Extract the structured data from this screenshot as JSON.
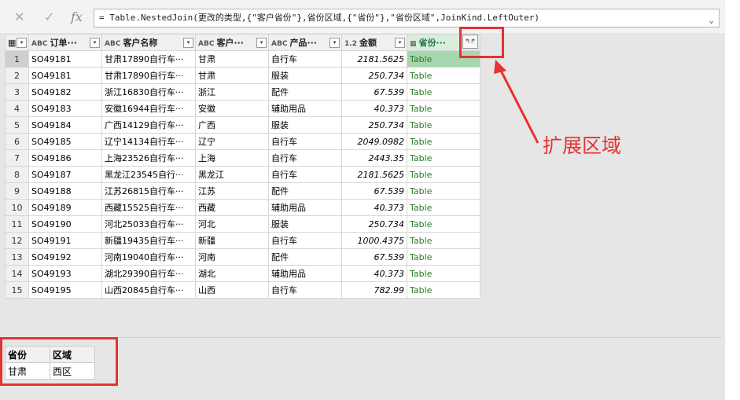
{
  "formula_bar": {
    "cancel_icon": "✕",
    "accept_icon": "✓",
    "fx_icon": "fx",
    "formula": "= Table.NestedJoin(更改的类型,{\"客户省份\"},省份区域,{\"省份\"},\"省份区域\",JoinKind.LeftOuter)",
    "chevron": "⌄"
  },
  "grid": {
    "corner_icon": "▦",
    "columns": [
      {
        "type": "ABC",
        "label": "订单···"
      },
      {
        "type": "ABC",
        "label": "客户名称"
      },
      {
        "type": "ABC",
        "label": "客户···"
      },
      {
        "type": "ABC",
        "label": "产品···"
      },
      {
        "type": "1.2",
        "label": "金额"
      },
      {
        "type": "▦",
        "label": "省份···"
      }
    ],
    "dropdown_icon": "▾",
    "expand_icon": "↰↱",
    "rows": [
      {
        "n": "1",
        "order": "SO49181",
        "customer": "甘肃17890自行车···",
        "prov": "甘肃",
        "product": "自行车",
        "amount": "2181.5625",
        "table": "Table"
      },
      {
        "n": "2",
        "order": "SO49181",
        "customer": "甘肃17890自行车···",
        "prov": "甘肃",
        "product": "服装",
        "amount": "250.734",
        "table": "Table"
      },
      {
        "n": "3",
        "order": "SO49182",
        "customer": "浙江16830自行车···",
        "prov": "浙江",
        "product": "配件",
        "amount": "67.539",
        "table": "Table"
      },
      {
        "n": "4",
        "order": "SO49183",
        "customer": "安徽16944自行车···",
        "prov": "安徽",
        "product": "辅助用品",
        "amount": "40.373",
        "table": "Table"
      },
      {
        "n": "5",
        "order": "SO49184",
        "customer": "广西14129自行车···",
        "prov": "广西",
        "product": "服装",
        "amount": "250.734",
        "table": "Table"
      },
      {
        "n": "6",
        "order": "SO49185",
        "customer": "辽宁14134自行车···",
        "prov": "辽宁",
        "product": "自行车",
        "amount": "2049.0982",
        "table": "Table"
      },
      {
        "n": "7",
        "order": "SO49186",
        "customer": "上海23526自行车···",
        "prov": "上海",
        "product": "自行车",
        "amount": "2443.35",
        "table": "Table"
      },
      {
        "n": "8",
        "order": "SO49187",
        "customer": "黑龙江23545自行···",
        "prov": "黑龙江",
        "product": "自行车",
        "amount": "2181.5625",
        "table": "Table"
      },
      {
        "n": "9",
        "order": "SO49188",
        "customer": "江苏26815自行车···",
        "prov": "江苏",
        "product": "配件",
        "amount": "67.539",
        "table": "Table"
      },
      {
        "n": "10",
        "order": "SO49189",
        "customer": "西藏15525自行车···",
        "prov": "西藏",
        "product": "辅助用品",
        "amount": "40.373",
        "table": "Table"
      },
      {
        "n": "11",
        "order": "SO49190",
        "customer": "河北25033自行车···",
        "prov": "河北",
        "product": "服装",
        "amount": "250.734",
        "table": "Table"
      },
      {
        "n": "12",
        "order": "SO49191",
        "customer": "新疆19435自行车···",
        "prov": "新疆",
        "product": "自行车",
        "amount": "1000.4375",
        "table": "Table"
      },
      {
        "n": "13",
        "order": "SO49192",
        "customer": "河南19040自行车···",
        "prov": "河南",
        "product": "配件",
        "amount": "67.539",
        "table": "Table"
      },
      {
        "n": "14",
        "order": "SO49193",
        "customer": "湖北29390自行车···",
        "prov": "湖北",
        "product": "辅助用品",
        "amount": "40.373",
        "table": "Table"
      },
      {
        "n": "15",
        "order": "SO49195",
        "customer": "山西20845自行车···",
        "prov": "山西",
        "product": "自行车",
        "amount": "782.99",
        "table": "Table"
      }
    ]
  },
  "annotation": {
    "label": "扩展区域",
    "color": "#e53232"
  },
  "preview": {
    "headers": [
      "省份",
      "区域"
    ],
    "row": [
      "甘肃",
      "西区"
    ]
  }
}
